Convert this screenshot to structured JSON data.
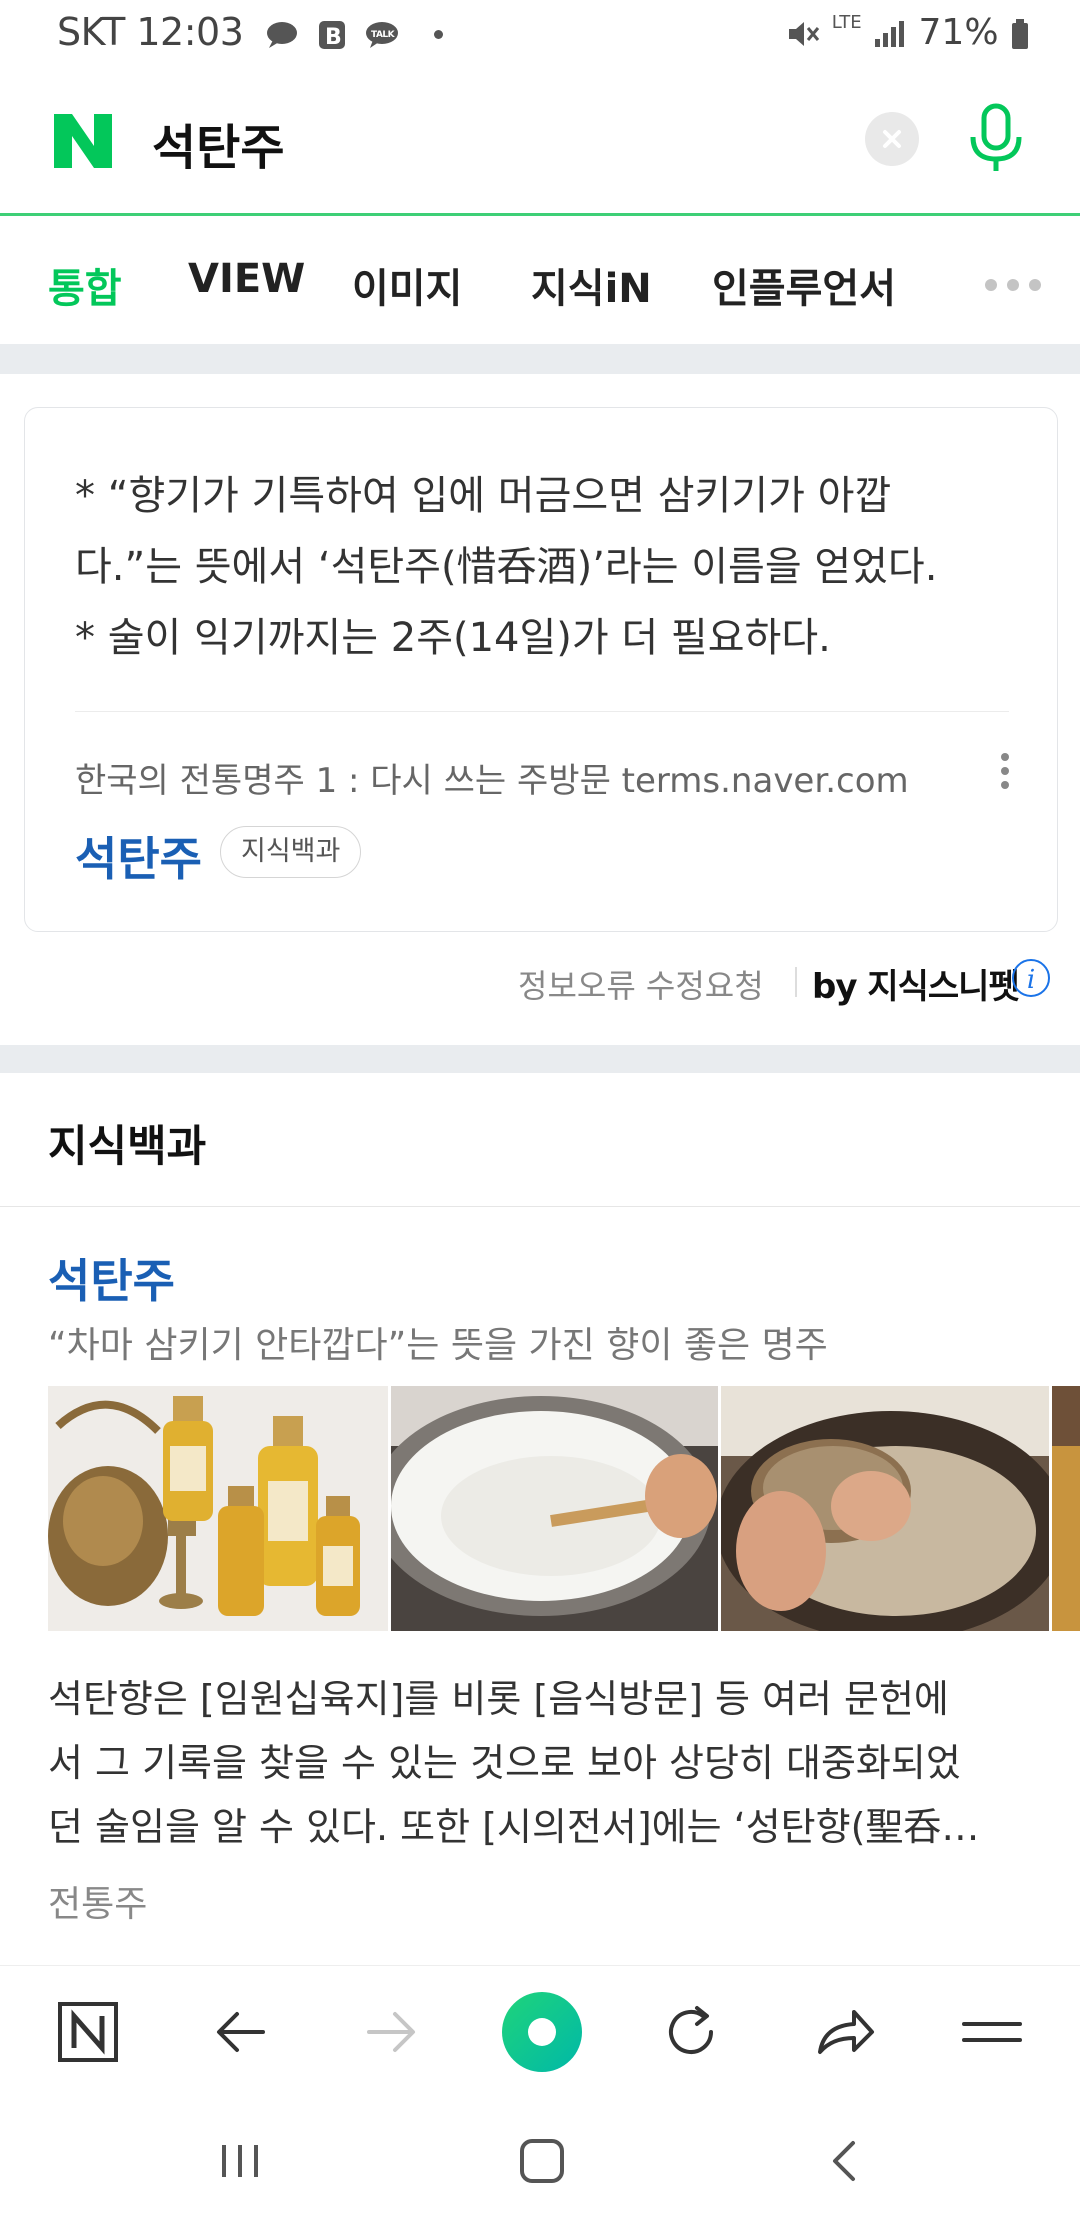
{
  "status_bar": {
    "carrier_time": "SKT 12:03",
    "network": "LTE",
    "battery": "71%",
    "icons": [
      "chat-bubble-icon",
      "blog-b-icon",
      "kakaotalk-icon",
      "dot-icon",
      "mute-icon",
      "signal-icon",
      "battery-icon"
    ]
  },
  "search": {
    "query": "석탄주"
  },
  "tabs": [
    {
      "label": "통합",
      "active": true
    },
    {
      "label": "VIEW",
      "active": false
    },
    {
      "label": "이미지",
      "active": false
    },
    {
      "label": "지식iN",
      "active": false
    },
    {
      "label": "인플루언서",
      "active": false
    }
  ],
  "snippet": {
    "lines": [
      "* “향기가 기특하여 입에 머금으면 삼키기가 아깝",
      "다.”는 뜻에서 ‘석탄주(惜呑酒)’라는 이름을 얻었다.",
      "* 술이 익기까지는 2주(14일)가 더 필요하다."
    ],
    "source": "한국의 전통명주 1 : 다시 쓰는 주방문 terms.naver.com",
    "title": "석탄주",
    "badge": "지식백과"
  },
  "snippet_footer": {
    "report": "정보오류 수정요청",
    "by": "by 지식스니펫",
    "info": "i"
  },
  "knowledge": {
    "heading": "지식백과",
    "title": "석탄주",
    "subtitle": "“차마 삼키기 안타깝다”는 뜻을 가진 향이 좋은 명주",
    "description": [
      "석탄향은 [임원십육지]를 비롯 [음식방문] 등 여러 문헌에",
      "서 그 기록을 찾을 수 있는 것으로 보아 상당히 대중화되었",
      "던 술임을 알 수 있다. 또한 [시의전서]에는 ‘성탄향(聖呑…"
    ],
    "category": "전통주"
  },
  "colors": {
    "naver_green": "#03c75a",
    "link_blue": "#1a5fb4",
    "divider": "#e9ecef"
  }
}
